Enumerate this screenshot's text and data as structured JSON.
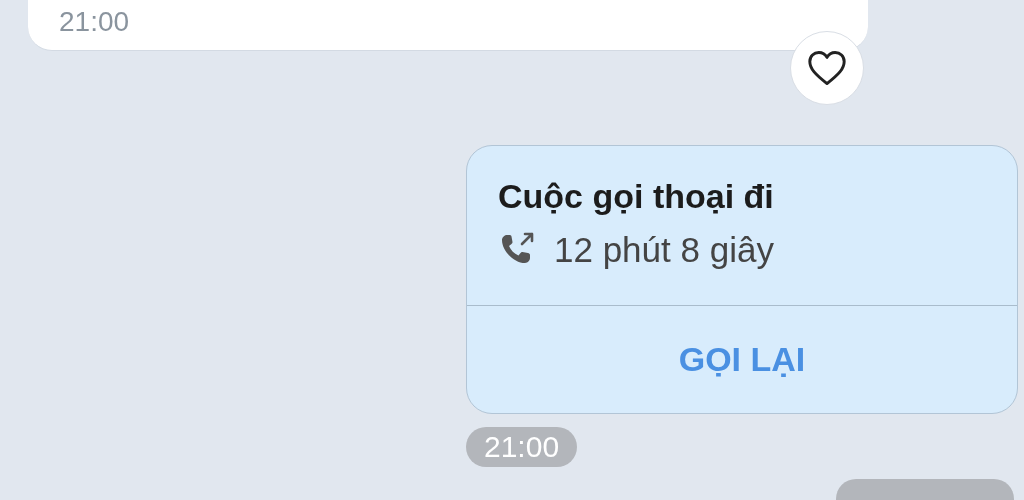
{
  "messages": [
    {
      "kind": "received_text",
      "time": "21:00",
      "reaction": {
        "liked": false
      }
    },
    {
      "kind": "outgoing_call",
      "title": "Cuộc gọi thoại đi",
      "duration": "12 phút 8 giây",
      "action": "GỌI LẠI"
    }
  ],
  "time_separator": "21:00"
}
